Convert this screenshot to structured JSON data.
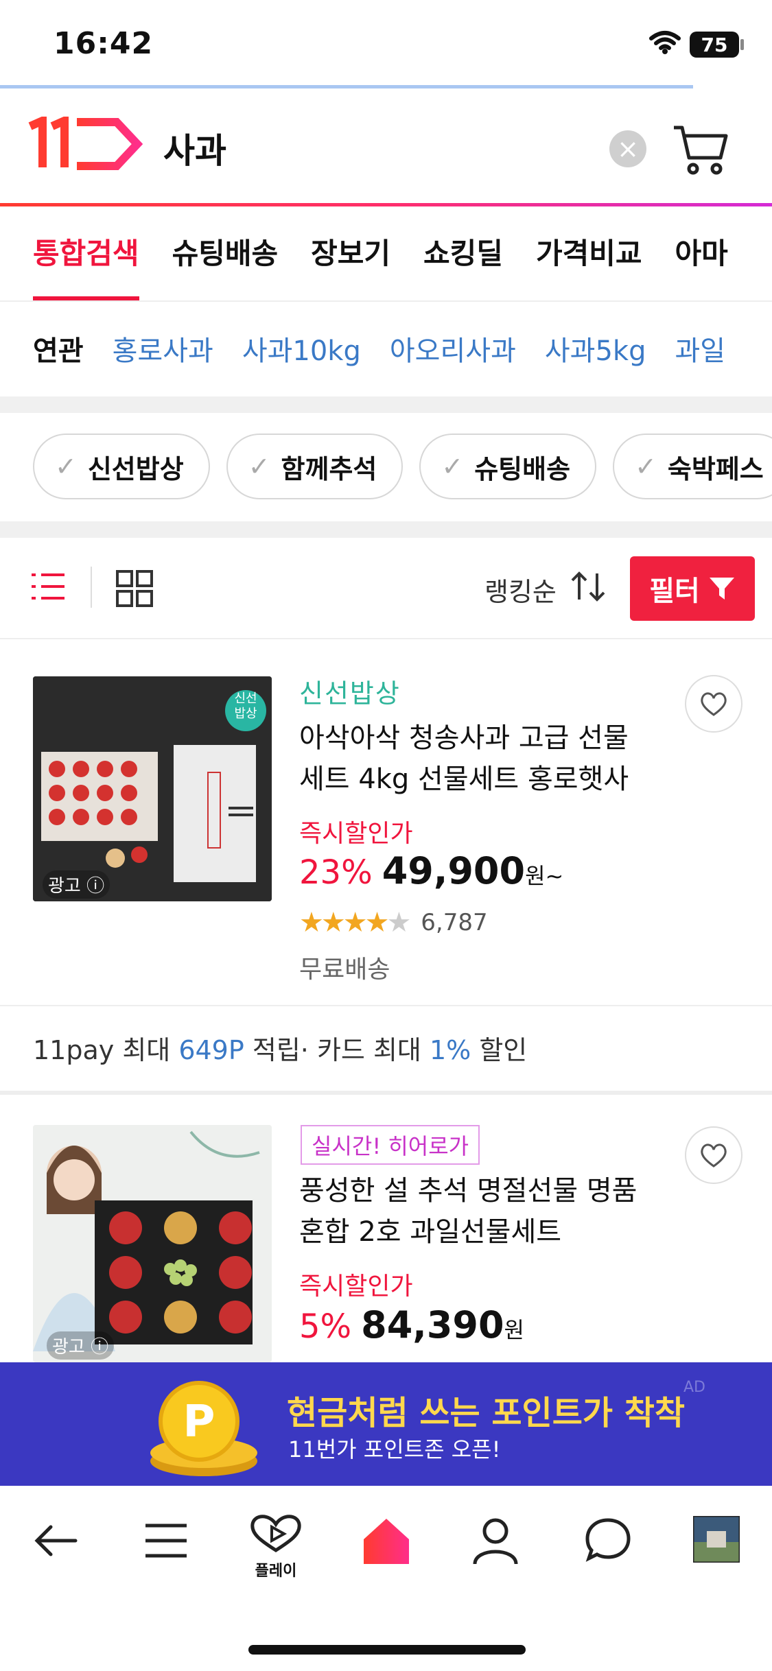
{
  "status_bar": {
    "time": "16:42",
    "battery": "75"
  },
  "header": {
    "logo_text": "11",
    "query": "사과"
  },
  "tabs": [
    {
      "label": "통합검색"
    },
    {
      "label": "슈팅배송"
    },
    {
      "label": "장보기"
    },
    {
      "label": "쇼킹딜"
    },
    {
      "label": "가격비교"
    },
    {
      "label": "아마"
    }
  ],
  "related": {
    "label": "연관",
    "items": [
      "홍로사과",
      "사과10kg",
      "아오리사과",
      "사과5kg",
      "과일"
    ]
  },
  "chips": [
    "신선밥상",
    "함께추석",
    "슈팅배송",
    "숙박페스"
  ],
  "toolbar": {
    "sort_label": "랭킹순",
    "filter_label": "필터"
  },
  "products": [
    {
      "brand": "신선밥상",
      "title": "아삭아삭 청송사과 고급 선물세트 4kg 선물세트 홍로햇사",
      "title_line1": "아삭아삭 청송사과 고급 선물",
      "title_line2": "세트 4kg 선물세트 홍로햇사",
      "discount_label": "즉시할인가",
      "discount_pct": "23%",
      "price": "49,900",
      "won": "원~",
      "rating": 4.5,
      "rating_count": "6,787",
      "shipping": "무료배송",
      "ad_label": "광고",
      "image_sticker": "신선\n밥상",
      "pay_line": {
        "prefix": "11pay 최대 ",
        "points": "649P",
        "mid": " 적립· 카드 최대 ",
        "pct": "1%",
        "suffix": " 할인"
      }
    },
    {
      "badge": "실시간! 히어로가",
      "title_line1": "풍성한 설 추석 명절선물 명품",
      "title_line2": "혼합 2호 과일선물세트",
      "discount_label": "즉시할인가",
      "discount_pct": "5%",
      "price": "84,390",
      "won": "원",
      "ad_label": "광고"
    }
  ],
  "banner": {
    "title": "현금처럼 쓰는 포인트가 착착",
    "subtitle": "11번가 포인트존 오픈!",
    "ad": "AD"
  },
  "bottom_nav": {
    "play_label": "플레이"
  },
  "colors": {
    "accent": "#f0153d",
    "link_blue": "#3a79c6",
    "banner_bg": "#3b38c1",
    "green": "#2eb49a"
  }
}
